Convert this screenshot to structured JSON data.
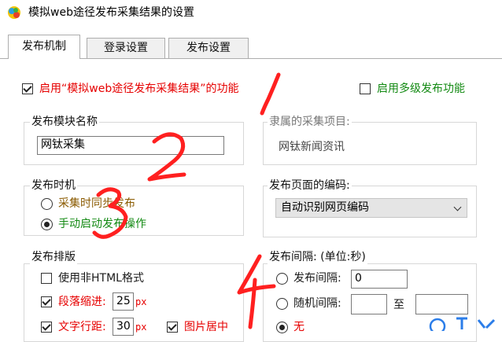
{
  "window": {
    "title": "模拟web途径发布采集结果的设置"
  },
  "tabs": [
    {
      "label": "发布机制",
      "active": true
    },
    {
      "label": "登录设置",
      "active": false
    },
    {
      "label": "发布设置",
      "active": false
    }
  ],
  "options": {
    "enable_web_publish": {
      "label": "启用“模拟web途径发布采集结果”的功能",
      "checked": true
    },
    "enable_multilevel": {
      "label": "启用多级发布功能",
      "checked": false
    }
  },
  "module_name": {
    "title": "发布模块名称",
    "value": "网钛采集"
  },
  "project": {
    "title": "隶属的采集项目:",
    "value": "网钛新闻资讯"
  },
  "publish_timing": {
    "title": "发布时机",
    "options": [
      {
        "label": "采集时同步发布",
        "selected": false
      },
      {
        "label": "手动启动发布操作",
        "selected": true
      }
    ]
  },
  "encoding": {
    "title": "发布页面的编码:",
    "selected": "自动识别网页编码"
  },
  "layout": {
    "title": "发布排版",
    "non_html": {
      "label": "使用非HTML格式",
      "checked": false
    },
    "indent": {
      "label": "段落缩进:",
      "value": "25",
      "unit": "px",
      "checked": true
    },
    "line_spacing": {
      "label": "文字行距:",
      "value": "30",
      "unit": "px",
      "checked": true
    },
    "center_images": {
      "label": "图片居中",
      "checked": true
    }
  },
  "interval": {
    "title": "发布间隔: (单位:秒)",
    "fixed": {
      "label": "发布间隔:",
      "value": "0",
      "selected": false
    },
    "random": {
      "label": "随机间隔:",
      "from": "",
      "to_label": "至",
      "to": "",
      "selected": false
    },
    "none": {
      "label": "无",
      "selected": true
    }
  },
  "annotations": [
    "1",
    "2",
    "3",
    "4"
  ],
  "colors": {
    "accent_red": "#e60000",
    "accent_green": "#138a13",
    "scrawl": "#ff2020"
  }
}
